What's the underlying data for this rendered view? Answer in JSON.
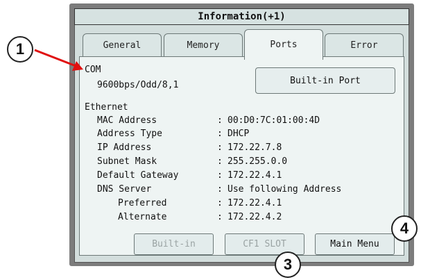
{
  "window": {
    "title": "Information(+1)"
  },
  "tabs": [
    {
      "label": "General"
    },
    {
      "label": "Memory"
    },
    {
      "label": "Ports",
      "active": true
    },
    {
      "label": "Error"
    }
  ],
  "com": {
    "heading": "COM",
    "setting": "9600bps/Odd/8,1",
    "port_button": "Built-in Port"
  },
  "ethernet": {
    "heading": "Ethernet",
    "rows": [
      {
        "label": "MAC Address",
        "value": "00:D0:7C:01:00:4D"
      },
      {
        "label": "Address Type",
        "value": "DHCP"
      },
      {
        "label": "IP Address",
        "value": "172.22.7.8"
      },
      {
        "label": "Subnet Mask",
        "value": "255.255.0.0"
      },
      {
        "label": "Default Gateway",
        "value": "172.22.4.1"
      },
      {
        "label": "DNS Server",
        "value": "Use following Address"
      },
      {
        "label": "Preferred",
        "value": "172.22.4.1"
      },
      {
        "label": "Alternate",
        "value": "172.22.4.2"
      }
    ],
    "separator": ":"
  },
  "buttons": {
    "builtin": "Built-in",
    "cf1_slot": "CF1 SLOT",
    "main_menu": "Main Menu"
  },
  "callouts": [
    "1",
    "3",
    "4"
  ],
  "colors": {
    "arrow": "#e01010",
    "screen_bg": "#eef4f3",
    "bezel": "#7c7c7c"
  }
}
